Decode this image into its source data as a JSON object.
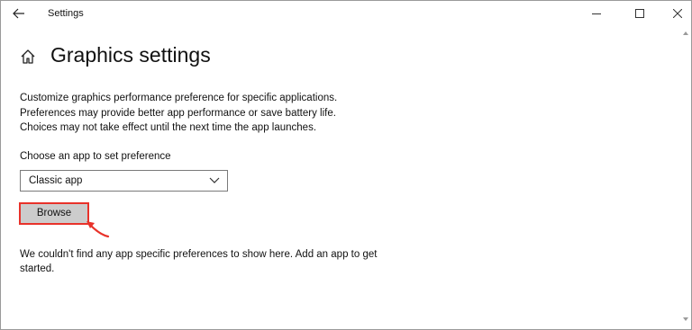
{
  "window": {
    "title": "Settings"
  },
  "page": {
    "title": "Graphics settings",
    "description": [
      "Customize graphics performance preference for specific applications.",
      "Preferences may provide better app performance or save battery life.",
      "Choices may not take effect until the next time the app launches."
    ],
    "choose_label": "Choose an app to set preference",
    "dropdown": {
      "selected": "Classic app"
    },
    "browse_label": "Browse",
    "empty_message": "We couldn't find any app specific preferences to show here. Add an app to get started."
  },
  "colors": {
    "annotation": "#e8322a",
    "button_bg": "#cccccc"
  },
  "icons": [
    "back-arrow-icon",
    "minimize-icon",
    "maximize-icon",
    "close-icon",
    "home-icon",
    "chevron-down-icon",
    "annotation-arrow-icon"
  ]
}
